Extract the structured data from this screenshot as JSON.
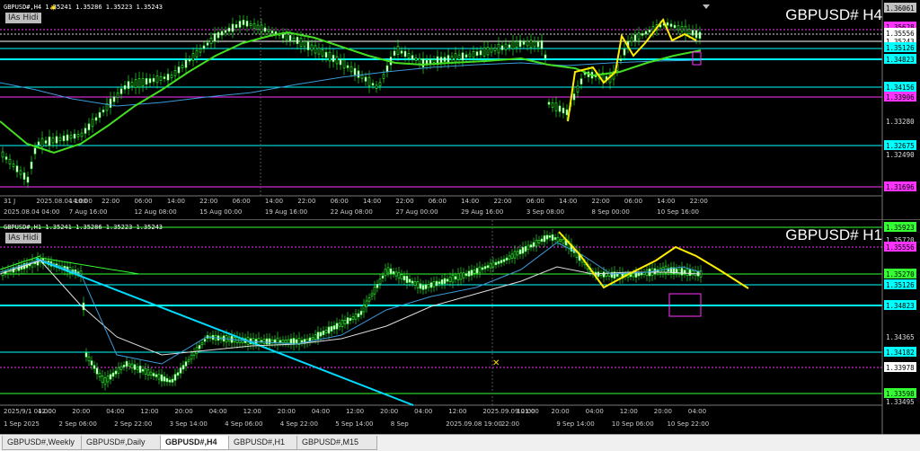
{
  "h4": {
    "info": "GBPUSD#,H4 1.35241 1.35286 1.35223 1.35243",
    "ias": "IAs Hidi",
    "title": "GBPUSD# H4",
    "prices": [
      {
        "v": "1.36061",
        "c": "#c0c0c0",
        "tc": "#000"
      },
      {
        "v": "1.35628",
        "c": "#ff33ff",
        "tc": "#000"
      },
      {
        "v": "1.35556",
        "c": "#ffffff",
        "tc": "#000"
      },
      {
        "v": "1.35243",
        "c": "#ffffff",
        "tc": "#000"
      },
      {
        "v": "1.35126",
        "c": "#00ffff",
        "tc": "#000"
      },
      {
        "v": "1.34823",
        "c": "#00ffff",
        "tc": "#000"
      },
      {
        "v": "1.34156",
        "c": "#00ffff",
        "tc": "#000"
      },
      {
        "v": "1.33906",
        "c": "#ff33ff",
        "tc": "#000"
      },
      {
        "v": "1.33280",
        "c": "",
        "tc": "#ddd"
      },
      {
        "v": "1.32675",
        "c": "#00ffff",
        "tc": "#000"
      },
      {
        "v": "1.32490",
        "c": "",
        "tc": "#ddd"
      },
      {
        "v": "1.31696",
        "c": "#ff33ff",
        "tc": "#000"
      }
    ],
    "times_row1": [
      "31 J",
      "2025.08.04 10:00",
      "14:00",
      "22:00",
      "06:00",
      "14:00",
      "22:00",
      "06:00",
      "14:00",
      "22:00",
      "06:00",
      "14:00",
      "22:00",
      "06:00",
      "14:00",
      "22:00",
      "06:00",
      "14:00",
      "22:00",
      "06:00",
      "14:00",
      "22:00"
    ],
    "times_row2": [
      "2025.08.04 04:00",
      "7 Aug 16:00",
      "12 Aug 08:00",
      "15 Aug 00:00",
      "19 Aug 16:00",
      "22 Aug 08:00",
      "27 Aug 00:00",
      "29 Aug 16:00",
      "3 Sep 08:00",
      "8 Sep 00:00",
      "10 Sep 16:00"
    ]
  },
  "h1": {
    "info": "GBPUSD#,H1 1.35241 1.35286 1.35223 1.35243",
    "ias": "IAs Hidi",
    "title": "GBPUSD# H1",
    "prices": [
      {
        "v": "1.35923",
        "c": "#33ff33",
        "tc": "#000"
      },
      {
        "v": "1.35720",
        "c": "",
        "tc": "#ddd"
      },
      {
        "v": "1.35556",
        "c": "#ff33ff",
        "tc": "#000"
      },
      {
        "v": "1.35270",
        "c": "#33ff33",
        "tc": "#000"
      },
      {
        "v": "1.35126",
        "c": "#00ffff",
        "tc": "#000"
      },
      {
        "v": "1.34823",
        "c": "#00ffff",
        "tc": "#000"
      },
      {
        "v": "1.34365",
        "c": "",
        "tc": "#ddd"
      },
      {
        "v": "1.34182",
        "c": "#00ffff",
        "tc": "#000"
      },
      {
        "v": "1.33978",
        "c": "#ffffff",
        "tc": "#000"
      },
      {
        "v": "1.33598",
        "c": "#33ff33",
        "tc": "#000"
      },
      {
        "v": "1.33495",
        "c": "",
        "tc": "#ddd"
      }
    ],
    "times_row1": [
      "2025/9/1 04:00",
      "12:00",
      "20:00",
      "04:00",
      "12:00",
      "20:00",
      "04:00",
      "12:00",
      "20:00",
      "04:00",
      "12:00",
      "20:00",
      "04:00",
      "12:00",
      "2025.09.09 01:00",
      "12:00",
      "20:00",
      "04:00",
      "12:00",
      "20:00",
      "04:00"
    ],
    "times_row2": [
      "1 Sep 2025",
      "2 Sep 06:00",
      "2 Sep 22:00",
      "3 Sep 14:00",
      "4 Sep 06:00",
      "4 Sep 22:00",
      "5 Sep 14:00",
      "8 Sep",
      "2025.09.08 19:00",
      "22:00",
      "9 Sep 14:00",
      "10 Sep 06:00",
      "10 Sep 22:00"
    ]
  },
  "tabs": [
    {
      "label": "GBPUSD#,Weekly",
      "active": false
    },
    {
      "label": "GBPUSD#,Daily",
      "active": false
    },
    {
      "label": "GBPUSD#,H4",
      "active": true
    },
    {
      "label": "GBPUSD#,H1",
      "active": false
    },
    {
      "label": "GBPUSD#,M15",
      "active": false
    }
  ]
}
